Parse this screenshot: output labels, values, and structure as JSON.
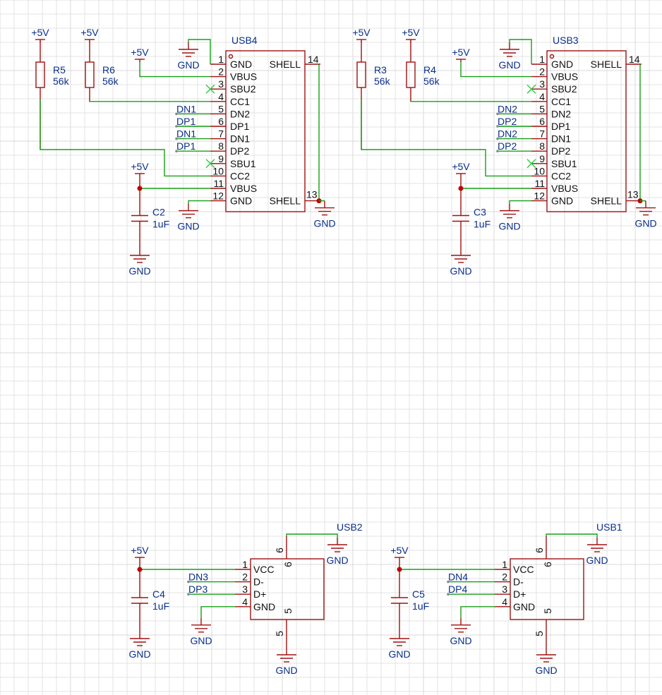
{
  "power_labels": {
    "vcc": "+5V",
    "gnd": "GND"
  },
  "usb_c": [
    {
      "ref": "USB4",
      "pins_left": [
        {
          "num": "1",
          "name": "GND"
        },
        {
          "num": "2",
          "name": "VBUS"
        },
        {
          "num": "3",
          "name": "SBU2"
        },
        {
          "num": "4",
          "name": "CC1"
        },
        {
          "num": "5",
          "name": "DN2"
        },
        {
          "num": "6",
          "name": "DP1"
        },
        {
          "num": "7",
          "name": "DN1"
        },
        {
          "num": "8",
          "name": "DP2"
        },
        {
          "num": "9",
          "name": "SBU1"
        },
        {
          "num": "10",
          "name": "CC2"
        },
        {
          "num": "11",
          "name": "VBUS"
        },
        {
          "num": "12",
          "name": "GND"
        }
      ],
      "pins_right": [
        {
          "num": "14",
          "name": "SHELL"
        },
        {
          "num": "13",
          "name": "SHELL"
        }
      ],
      "net_labels": [
        "DN1",
        "DP1",
        "DN1",
        "DP1"
      ],
      "resistors": [
        {
          "ref": "R5",
          "value": "56k"
        },
        {
          "ref": "R6",
          "value": "56k"
        }
      ],
      "cap": {
        "ref": "C2",
        "value": "1uF"
      }
    },
    {
      "ref": "USB3",
      "pins_left": [
        {
          "num": "1",
          "name": "GND"
        },
        {
          "num": "2",
          "name": "VBUS"
        },
        {
          "num": "3",
          "name": "SBU2"
        },
        {
          "num": "4",
          "name": "CC1"
        },
        {
          "num": "5",
          "name": "DN2"
        },
        {
          "num": "6",
          "name": "DP1"
        },
        {
          "num": "7",
          "name": "DN1"
        },
        {
          "num": "8",
          "name": "DP2"
        },
        {
          "num": "9",
          "name": "SBU1"
        },
        {
          "num": "10",
          "name": "CC2"
        },
        {
          "num": "11",
          "name": "VBUS"
        },
        {
          "num": "12",
          "name": "GND"
        }
      ],
      "pins_right": [
        {
          "num": "14",
          "name": "SHELL"
        },
        {
          "num": "13",
          "name": "SHELL"
        }
      ],
      "net_labels": [
        "DN2",
        "DP2",
        "DN2",
        "DP2"
      ],
      "resistors": [
        {
          "ref": "R3",
          "value": "56k"
        },
        {
          "ref": "R4",
          "value": "56k"
        }
      ],
      "cap": {
        "ref": "C3",
        "value": "1uF"
      }
    }
  ],
  "usb_a": [
    {
      "ref": "USB2",
      "pins_left": [
        {
          "num": "1",
          "name": "VCC"
        },
        {
          "num": "2",
          "name": "D-"
        },
        {
          "num": "3",
          "name": "D+"
        },
        {
          "num": "4",
          "name": "GND"
        }
      ],
      "pin_top": "6",
      "pin_bottom": "5",
      "net_labels": [
        "DN3",
        "DP3"
      ],
      "cap": {
        "ref": "C4",
        "value": "1uF"
      }
    },
    {
      "ref": "USB1",
      "pins_left": [
        {
          "num": "1",
          "name": "VCC"
        },
        {
          "num": "2",
          "name": "D-"
        },
        {
          "num": "3",
          "name": "D+"
        },
        {
          "num": "4",
          "name": "GND"
        }
      ],
      "pin_top": "6",
      "pin_bottom": "5",
      "net_labels": [
        "DN4",
        "DP4"
      ],
      "cap": {
        "ref": "C5",
        "value": "1uF"
      }
    }
  ],
  "colors": {
    "component": "#a01010",
    "wire": "#17a017",
    "reference": "#0a2f8a",
    "junction": "#c00000",
    "grid": "#e3e3e3"
  }
}
